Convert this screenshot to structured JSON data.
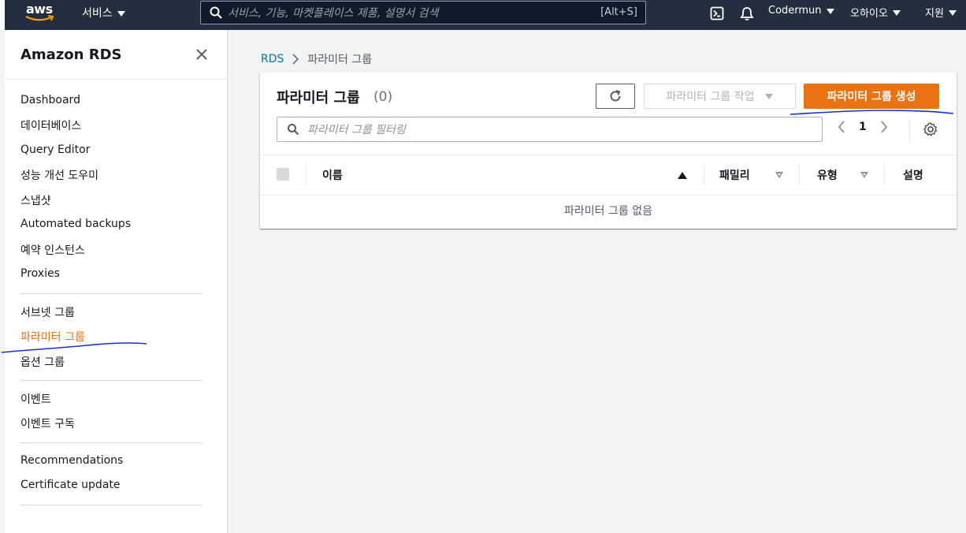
{
  "topnav": {
    "logo_text": "aws",
    "services_label": "서비스",
    "search_placeholder": "서비스, 기능, 마켓플레이스 제품, 설명서 검색",
    "search_shortcut": "[Alt+S]",
    "account": "Codermun",
    "region": "오하이오",
    "support": "지원",
    "bg_color": "#232f3e"
  },
  "sidebar": {
    "title": "Amazon RDS",
    "items": [
      {
        "label": "Dashboard"
      },
      {
        "label": "데이터베이스"
      },
      {
        "label": "Query Editor"
      },
      {
        "label": "성능 개선 도우미"
      },
      {
        "label": "스냅샷"
      },
      {
        "label": "Automated backups"
      },
      {
        "label": "예약 인스턴스"
      },
      {
        "label": "Proxies"
      },
      {
        "label": "서브넷 그룹"
      },
      {
        "label": "파라미터 그룹",
        "active": true
      },
      {
        "label": "옵션 그룹"
      },
      {
        "label": "이벤트"
      },
      {
        "label": "이벤트 구독"
      },
      {
        "label": "Recommendations"
      },
      {
        "label": "Certificate update"
      }
    ]
  },
  "breadcrumb": {
    "root": "RDS",
    "current": "파라미터 그룹"
  },
  "panel": {
    "title": "파라미터 그룹",
    "count": "(0)",
    "actions_label": "파라미터 그룹 작업",
    "create_label": "파라미터 그룹 생성",
    "filter_placeholder": "파라미터 그룹 필터링",
    "page": "1",
    "columns": [
      "이름",
      "패밀리",
      "유형",
      "설명"
    ],
    "empty_text": "파라미터 그룹 없음",
    "accent_color": "#ec7211"
  }
}
